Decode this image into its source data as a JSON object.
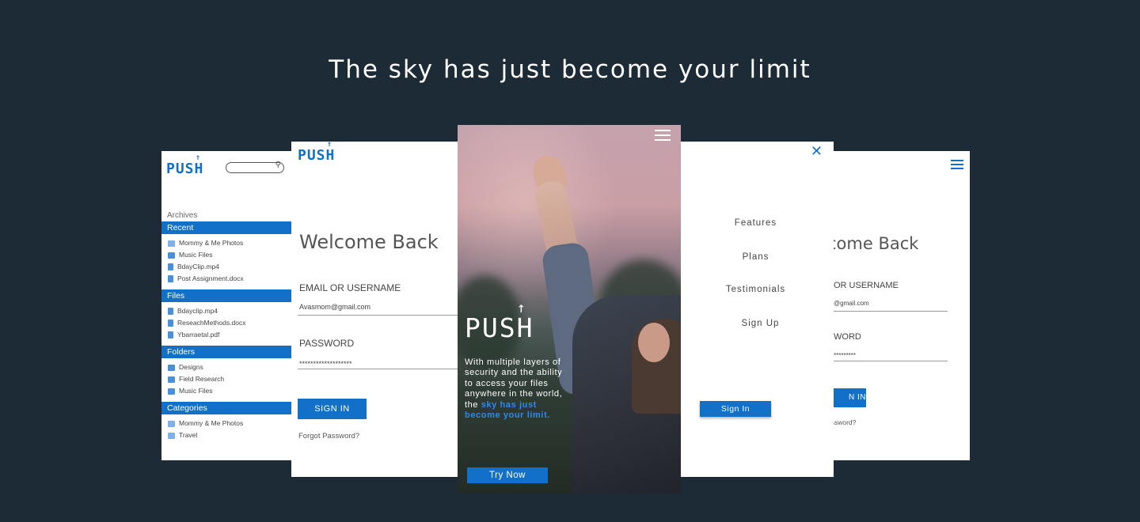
{
  "headline": "The sky has just become your limit",
  "brand": {
    "logo": "PUSH",
    "accent": "#1270c9",
    "background": "#1c2b36"
  },
  "files_screen": {
    "archives_label": "Archives",
    "sections": [
      {
        "title": "Recent",
        "items": [
          {
            "label": "Mommy & Me Photos",
            "icon": "image-icon"
          },
          {
            "label": "Music Files",
            "icon": "folder-icon"
          },
          {
            "label": "BdayClip.mp4",
            "icon": "file-icon"
          },
          {
            "label": "Post Assignment.docx",
            "icon": "file-icon"
          }
        ]
      },
      {
        "title": "Files",
        "items": [
          {
            "label": "Bdayclip.mp4",
            "icon": "file-icon"
          },
          {
            "label": "ReseachMethods.docx",
            "icon": "file-icon"
          },
          {
            "label": "Ybarraetal.pdf",
            "icon": "file-icon"
          }
        ]
      },
      {
        "title": "Folders",
        "items": [
          {
            "label": "Designs",
            "icon": "folder-icon"
          },
          {
            "label": "Field Research",
            "icon": "folder-icon"
          },
          {
            "label": "Music Files",
            "icon": "folder-icon"
          }
        ]
      },
      {
        "title": "Categories",
        "items": [
          {
            "label": "Mommy & Me Photos",
            "icon": "image-icon"
          },
          {
            "label": "Travel",
            "icon": "image-icon"
          }
        ]
      }
    ]
  },
  "login_screen": {
    "title": "Welcome Back",
    "email_label": "EMAIL OR USERNAME",
    "email_value": "Avasmom@gmail.com",
    "password_label": "PASSWORD",
    "password_value": "*******************",
    "sign_in_label": "SIGN IN",
    "forgot_label": "Forgot Password?"
  },
  "hero_screen": {
    "logo": "PUSH",
    "text_lead": "With multiple layers of security and the ability to access your files anywhere in the world, the ",
    "text_highlight": "sky has just become your limit.",
    "cta_label": "Try Now"
  },
  "menu_screen": {
    "items": [
      "Features",
      "Plans",
      "Testimonials",
      "Sign Up"
    ],
    "sign_in_label": "Sign In"
  },
  "login_partial_screen": {
    "title": "come Back",
    "email_label": "OR USERNAME",
    "email_value": "@gmail.com",
    "password_label": "WORD",
    "password_value": "*********",
    "sign_in_label": "N IN",
    "forgot_label": "assword?"
  }
}
